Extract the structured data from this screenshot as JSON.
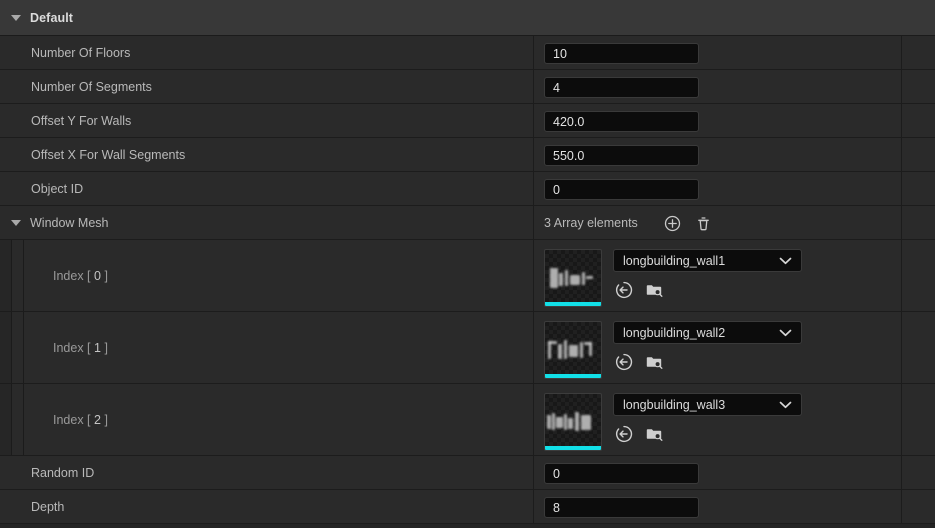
{
  "category": {
    "title": "Default",
    "expanded": true,
    "expander_icon": "triangle-down-icon"
  },
  "colors": {
    "panel_bg": "#242424",
    "row_bg": "#2a2a2a",
    "header_bg": "#383838",
    "field_bg": "#0c0c0c",
    "accent_cyan": "#12e0e8",
    "text": "#b9b9b9"
  },
  "properties": [
    {
      "label": "Number Of Floors",
      "value": "10",
      "type": "number"
    },
    {
      "label": "Number Of Segments",
      "value": "4",
      "type": "number"
    },
    {
      "label": "Offset Y For Walls",
      "value": "420.0",
      "type": "number"
    },
    {
      "label": "Offset X For Wall Segments",
      "value": "550.0",
      "type": "number"
    },
    {
      "label": "Object ID",
      "value": "0",
      "type": "number"
    }
  ],
  "array_property": {
    "label": "Window Mesh",
    "expanded": true,
    "expander_icon": "triangle-down-icon",
    "element_count_text": "3 Array elements",
    "add_icon": "plus-circle-icon",
    "add_tooltip": "Add Element",
    "delete_icon": "trash-icon",
    "delete_tooltip": "Remove All Elements",
    "elements": [
      {
        "index_prefix": "Index [",
        "index": "0",
        "index_suffix": "]",
        "asset_name": "longbuilding_wall1",
        "combo_icon": "chevron-down-icon",
        "browse_icon": "folder-search-icon",
        "use_selected_icon": "arrow-left-circle-icon",
        "expand_icon": "chevron-down-icon",
        "thumbnail_accent": "#12e0e8"
      },
      {
        "index_prefix": "Index [",
        "index": "1",
        "index_suffix": "]",
        "asset_name": "longbuilding_wall2",
        "combo_icon": "chevron-down-icon",
        "browse_icon": "folder-search-icon",
        "use_selected_icon": "arrow-left-circle-icon",
        "expand_icon": "chevron-down-icon",
        "thumbnail_accent": "#12e0e8"
      },
      {
        "index_prefix": "Index [",
        "index": "2",
        "index_suffix": "]",
        "asset_name": "longbuilding_wall3",
        "combo_icon": "chevron-down-icon",
        "browse_icon": "folder-search-icon",
        "use_selected_icon": "arrow-left-circle-icon",
        "expand_icon": "chevron-down-icon",
        "thumbnail_accent": "#12e0e8"
      }
    ]
  },
  "properties_after": [
    {
      "label": "Random ID",
      "value": "0",
      "type": "number"
    },
    {
      "label": "Depth",
      "value": "8",
      "type": "number"
    }
  ]
}
